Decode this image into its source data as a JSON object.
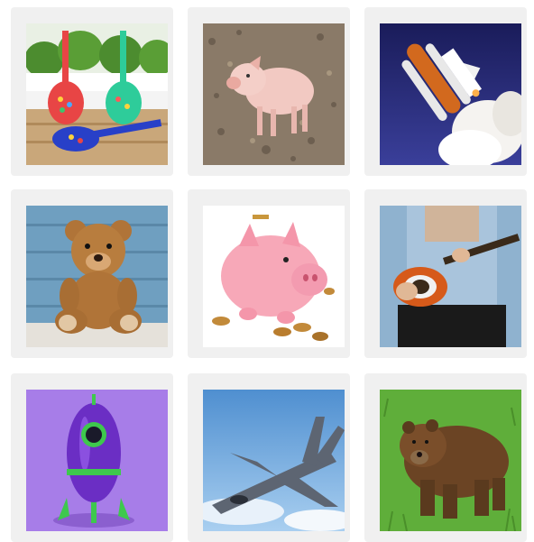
{
  "grid": {
    "tiles": [
      {
        "icon": "toy-guitars-image"
      },
      {
        "icon": "piglet-image"
      },
      {
        "icon": "space-shuttle-launch-image"
      },
      {
        "icon": "teddy-bear-image"
      },
      {
        "icon": "piggy-bank-image"
      },
      {
        "icon": "electric-guitar-player-image"
      },
      {
        "icon": "toy-rocket-image"
      },
      {
        "icon": "fighter-jet-image"
      },
      {
        "icon": "brown-bear-image"
      }
    ]
  }
}
